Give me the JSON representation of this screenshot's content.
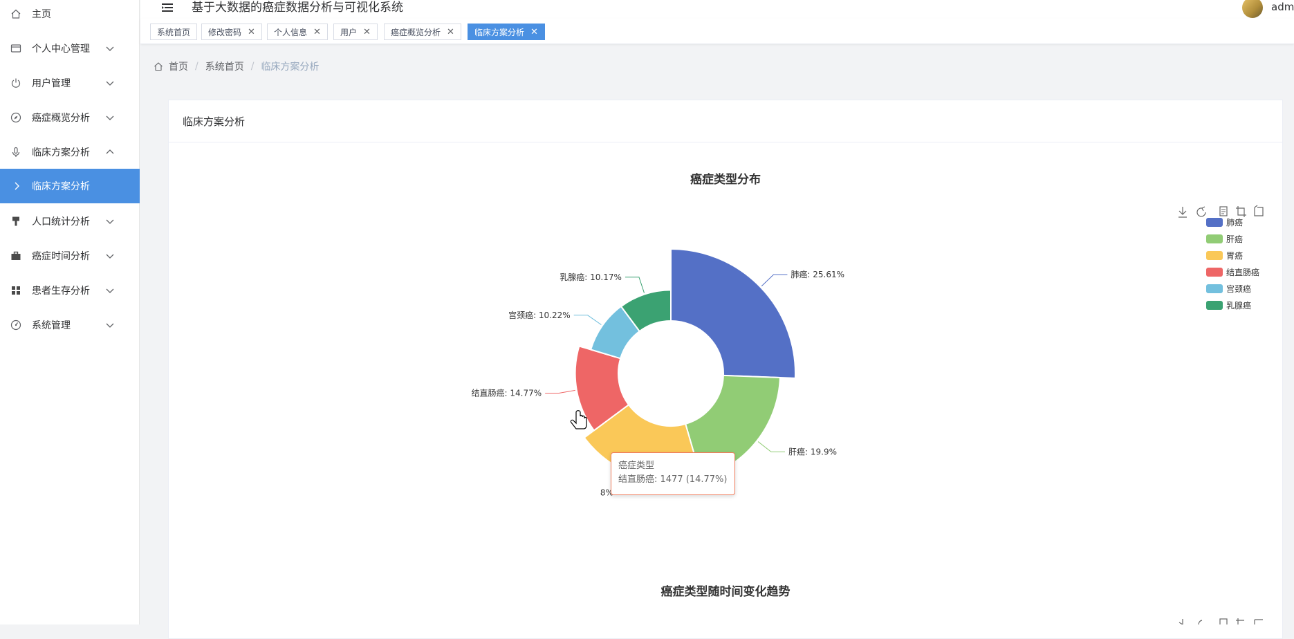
{
  "app": {
    "title": "基于大数据的癌症数据分析与可视化系统",
    "user": "admi"
  },
  "sidebar": {
    "items": [
      {
        "label": "主页",
        "icon": "home-icon",
        "expandable": false
      },
      {
        "label": "个人中心管理",
        "icon": "wallet-icon",
        "expandable": true
      },
      {
        "label": "用户管理",
        "icon": "power-icon",
        "expandable": true
      },
      {
        "label": "癌症概览分析",
        "icon": "compass-icon",
        "expandable": true
      },
      {
        "label": "临床方案分析",
        "icon": "microphone-icon",
        "expandable": true,
        "expanded": true
      },
      {
        "label": "临床方案分析",
        "icon": "chevron-right-icon",
        "active": true
      },
      {
        "label": "人口统计分析",
        "icon": "brush-icon",
        "expandable": true
      },
      {
        "label": "癌症时间分析",
        "icon": "briefcase-icon",
        "expandable": true
      },
      {
        "label": "患者生存分析",
        "icon": "grid-icon",
        "expandable": true
      },
      {
        "label": "系统管理",
        "icon": "dashboard-icon",
        "expandable": true
      }
    ]
  },
  "tabs": [
    {
      "label": "系统首页",
      "closable": false
    },
    {
      "label": "修改密码",
      "closable": true
    },
    {
      "label": "个人信息",
      "closable": true
    },
    {
      "label": "用户",
      "closable": true
    },
    {
      "label": "癌症概览分析",
      "closable": true
    },
    {
      "label": "临床方案分析",
      "closable": true,
      "active": true
    }
  ],
  "breadcrumb": {
    "home": "首页",
    "second": "系统首页",
    "current": "临床方案分析"
  },
  "card": {
    "title": "临床方案分析"
  },
  "chart_data": [
    {
      "type": "pie",
      "variant": "rose-donut",
      "title": "癌症类型分布",
      "series_name": "癌症类型",
      "legend_position": "top-right",
      "slices": [
        {
          "name": "肺癌",
          "percent": 25.61,
          "label": "肺癌: 25.61%",
          "color": "#5470c6"
        },
        {
          "name": "肝癌",
          "percent": 19.9,
          "label": "肝癌: 19.9%",
          "color": "#91cc75"
        },
        {
          "name": "胃癌",
          "percent": 19.33,
          "label": "8%",
          "color": "#fac858"
        },
        {
          "name": "结直肠癌",
          "percent": 14.77,
          "value": 1477,
          "label": "结直肠癌: 14.77%",
          "color": "#ee6666"
        },
        {
          "name": "宫颈癌",
          "percent": 10.22,
          "label": "宫颈癌: 10.22%",
          "color": "#73c0de"
        },
        {
          "name": "乳腺癌",
          "percent": 10.17,
          "label": "乳腺癌: 10.17%",
          "color": "#3ba272"
        }
      ],
      "tooltip": {
        "title": "癌症类型",
        "text": "结直肠癌: 1477 (14.77%)"
      }
    },
    {
      "type": "line",
      "title": "癌症类型随时间变化趋势"
    }
  ],
  "colors": {
    "accent": "#4a90e2",
    "highlight_border": "#f07c5c"
  }
}
